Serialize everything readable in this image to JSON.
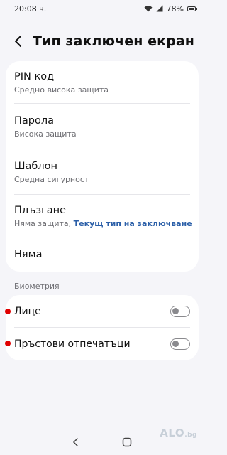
{
  "status": {
    "time": "20:08 ч.",
    "battery": "78%"
  },
  "header": {
    "title": "Тип заключен екран"
  },
  "options": [
    {
      "title": "PIN код",
      "subtitle": "Средно висока защита"
    },
    {
      "title": "Парола",
      "subtitle": "Висока защита"
    },
    {
      "title": "Шаблон",
      "subtitle": "Средна сигурност"
    },
    {
      "title": "Плъзгане",
      "subtitle": "Няма защита,",
      "link": "Текущ тип на заключване"
    },
    {
      "title": "Няма"
    }
  ],
  "biometrics": {
    "section_label": "Биометрия",
    "items": [
      {
        "title": "Лице",
        "enabled": false
      },
      {
        "title": "Пръстови отпечатъци",
        "enabled": false
      }
    ]
  },
  "watermark": {
    "text": "ALO",
    "suffix": ".bg"
  },
  "colors": {
    "link": "#2b5fa8",
    "background": "#f5f5f9",
    "card": "#ffffff",
    "marker": "#e00000"
  },
  "icons": [
    "wifi-icon",
    "signal-icon",
    "battery-icon",
    "back-arrow-icon",
    "nav-back-icon",
    "nav-home-icon"
  ]
}
